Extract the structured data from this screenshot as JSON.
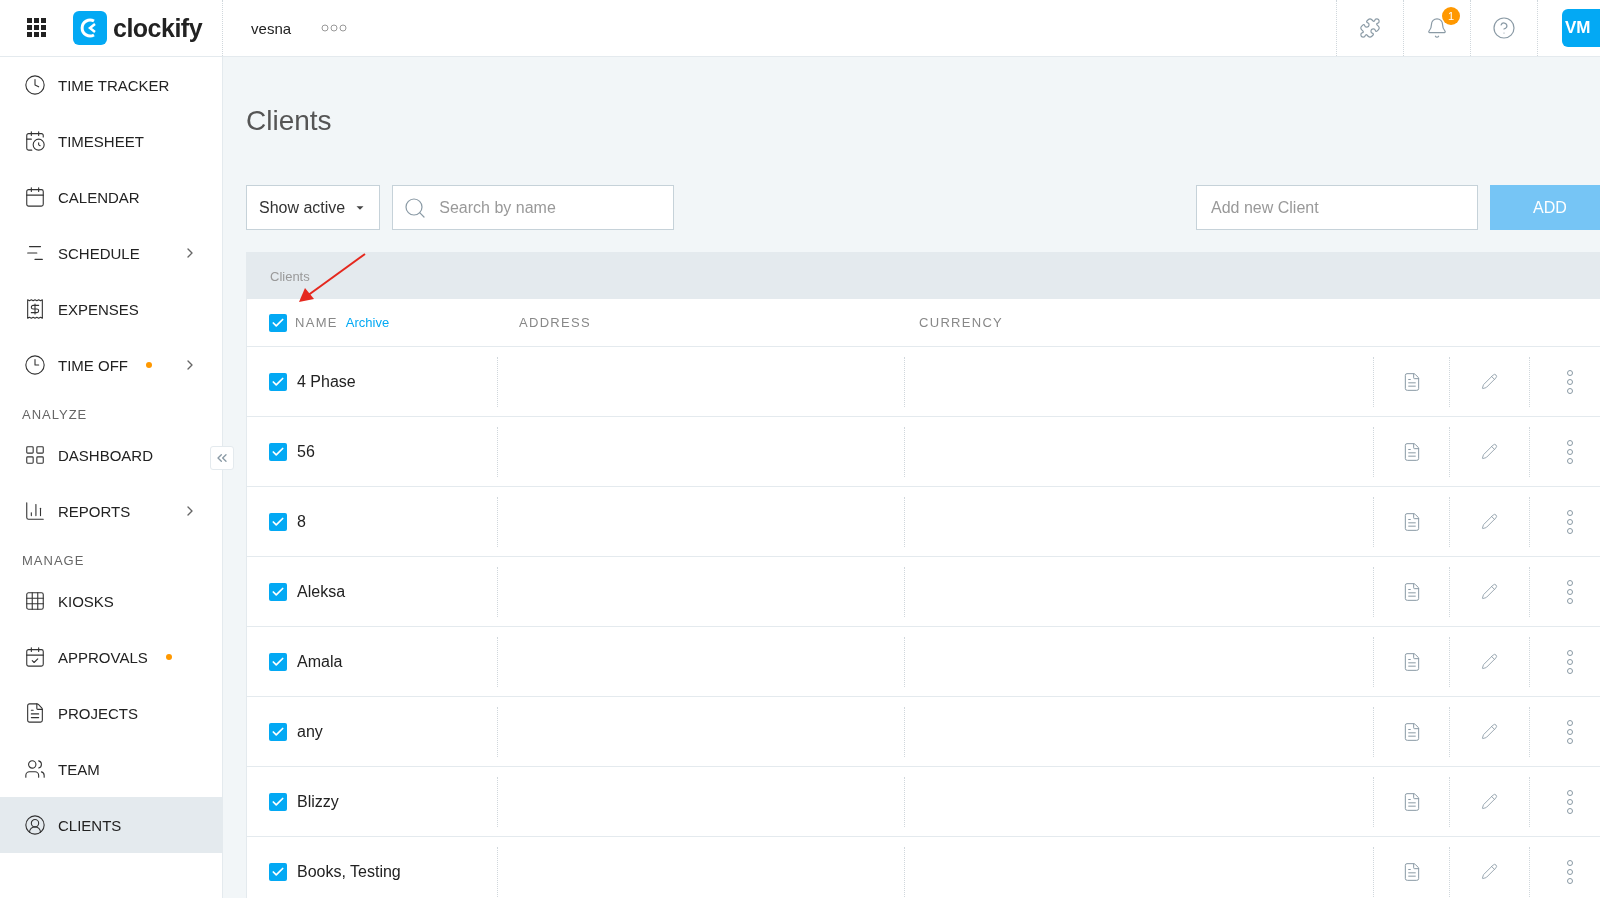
{
  "header": {
    "logo_text": "clockify",
    "workspace": "vesna",
    "notification_count": "1",
    "avatar_initials": "VM"
  },
  "sidebar": {
    "items": [
      {
        "kind": "item",
        "label": "TIME TRACKER",
        "submenu": false,
        "dot": false,
        "selected": false
      },
      {
        "kind": "item",
        "label": "TIMESHEET",
        "submenu": false,
        "dot": false,
        "selected": false
      },
      {
        "kind": "item",
        "label": "CALENDAR",
        "submenu": false,
        "dot": false,
        "selected": false
      },
      {
        "kind": "item",
        "label": "SCHEDULE",
        "submenu": true,
        "dot": false,
        "selected": false
      },
      {
        "kind": "item",
        "label": "EXPENSES",
        "submenu": false,
        "dot": false,
        "selected": false
      },
      {
        "kind": "item",
        "label": "TIME OFF",
        "submenu": true,
        "dot": true,
        "selected": false
      },
      {
        "kind": "section",
        "label": "ANALYZE"
      },
      {
        "kind": "item",
        "label": "DASHBOARD",
        "submenu": false,
        "dot": false,
        "selected": false
      },
      {
        "kind": "item",
        "label": "REPORTS",
        "submenu": true,
        "dot": false,
        "selected": false
      },
      {
        "kind": "section",
        "label": "MANAGE"
      },
      {
        "kind": "item",
        "label": "KIOSKS",
        "submenu": false,
        "dot": false,
        "selected": false
      },
      {
        "kind": "item",
        "label": "APPROVALS",
        "submenu": false,
        "dot": true,
        "selected": false
      },
      {
        "kind": "item",
        "label": "PROJECTS",
        "submenu": false,
        "dot": false,
        "selected": false
      },
      {
        "kind": "item",
        "label": "TEAM",
        "submenu": false,
        "dot": false,
        "selected": false
      },
      {
        "kind": "item",
        "label": "CLIENTS",
        "submenu": false,
        "dot": false,
        "selected": true
      }
    ]
  },
  "page": {
    "title": "Clients",
    "filter": "Show active",
    "search": {
      "placeholder": "Search by name"
    },
    "new_client": {
      "placeholder": "Add new Client"
    },
    "add_button": "ADD"
  },
  "table": {
    "caption": "Clients",
    "all_checked": true,
    "archive_link": "Archive",
    "columns": [
      "NAME",
      "ADDRESS",
      "CURRENCY"
    ],
    "rows": [
      {
        "name": "4 Phase",
        "checked": true
      },
      {
        "name": "56",
        "checked": true
      },
      {
        "name": "8",
        "checked": true
      },
      {
        "name": "Aleksa",
        "checked": true
      },
      {
        "name": "Amala",
        "checked": true
      },
      {
        "name": "any",
        "checked": true
      },
      {
        "name": "Blizzy",
        "checked": true
      },
      {
        "name": "Books, Testing",
        "checked": true
      }
    ]
  }
}
